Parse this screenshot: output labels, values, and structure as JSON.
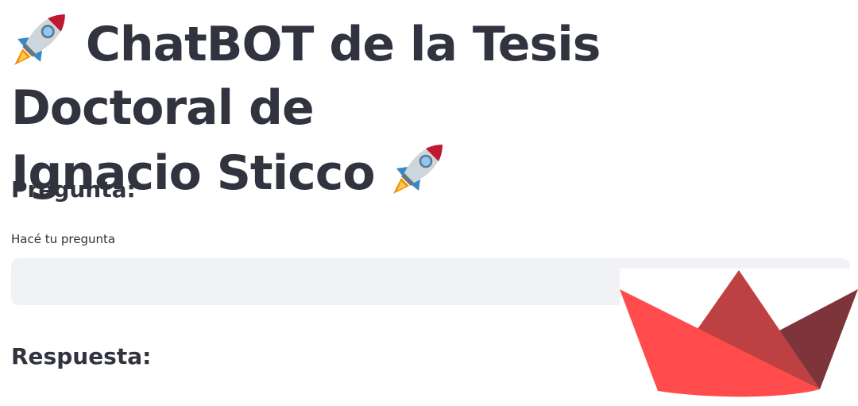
{
  "page": {
    "title_line1": "ChatBOT de la Tesis Doctoral de",
    "title_line2": "Ignacio Sticco",
    "title_icon": "rocket-emoji"
  },
  "question_section": {
    "heading": "Pregunta:",
    "input_label": "Hacé tu pregunta",
    "input_value": ""
  },
  "answer_section": {
    "heading": "Respuesta:"
  },
  "logo": {
    "name": "streamlit-logo",
    "colors": [
      "#ff4b4b",
      "#bd4043",
      "#7d353b"
    ]
  }
}
